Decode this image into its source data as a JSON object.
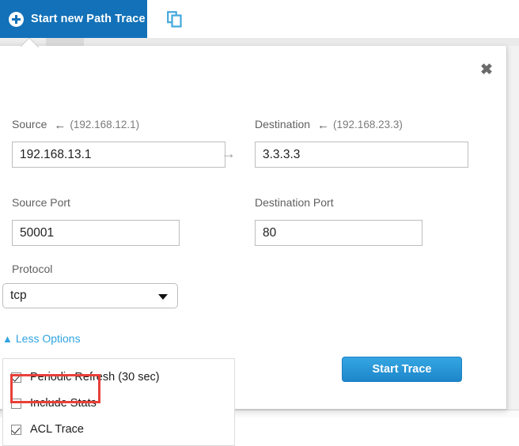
{
  "tabbar": {
    "new_trace_tab": "Start new Path Trace",
    "plus_icon": "plus-circle-icon",
    "copy_icon": "copy-icon"
  },
  "panel": {
    "close_icon": "close-icon",
    "source": {
      "label": "Source",
      "back_arrow": "←",
      "hint": "(192.168.12.1)",
      "value": "192.168.13.1"
    },
    "flow_arrow": "→",
    "destination": {
      "label": "Destination",
      "back_arrow": "←",
      "hint": "(192.168.23.3)",
      "value": "3.3.3.3"
    },
    "source_port": {
      "label": "Source Port",
      "value": "50001"
    },
    "destination_port": {
      "label": "Destination Port",
      "value": "80"
    },
    "protocol": {
      "label": "Protocol",
      "value": "tcp",
      "caret_icon": "chevron-down-icon"
    },
    "less_options": {
      "label": "Less Options",
      "icon": "double-chevron-up-icon"
    },
    "options": [
      {
        "label": "Periodic Refresh (30 sec)",
        "checked": true
      },
      {
        "label": "Include Stats",
        "checked": false
      },
      {
        "label": "ACL Trace",
        "checked": true
      }
    ],
    "start_trace": "Start Trace"
  },
  "colors": {
    "tab_blue": "#1271b8",
    "link_blue": "#2fa4e0",
    "button_blue_top": "#35a6e2",
    "button_blue_bottom": "#1d86ca",
    "highlight_red": "#e8403a"
  }
}
